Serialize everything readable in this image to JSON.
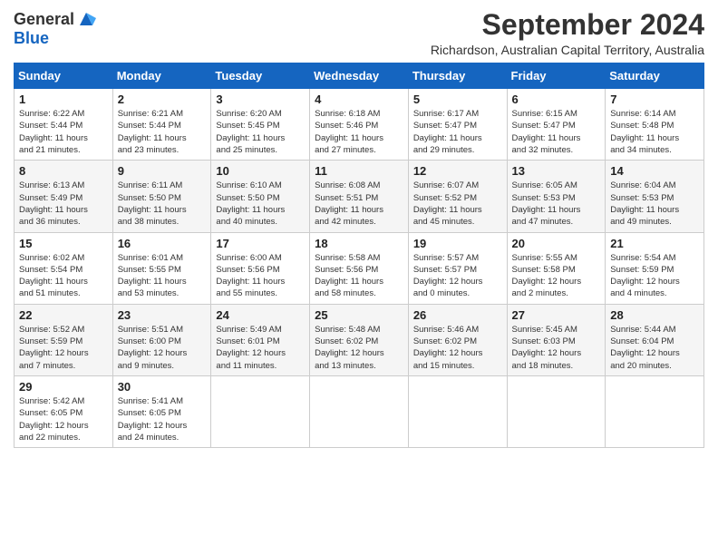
{
  "logo": {
    "general": "General",
    "blue": "Blue"
  },
  "title": "September 2024",
  "location": "Richardson, Australian Capital Territory, Australia",
  "weekdays": [
    "Sunday",
    "Monday",
    "Tuesday",
    "Wednesday",
    "Thursday",
    "Friday",
    "Saturday"
  ],
  "weeks": [
    [
      {
        "day": "1",
        "info": "Sunrise: 6:22 AM\nSunset: 5:44 PM\nDaylight: 11 hours\nand 21 minutes."
      },
      {
        "day": "2",
        "info": "Sunrise: 6:21 AM\nSunset: 5:44 PM\nDaylight: 11 hours\nand 23 minutes."
      },
      {
        "day": "3",
        "info": "Sunrise: 6:20 AM\nSunset: 5:45 PM\nDaylight: 11 hours\nand 25 minutes."
      },
      {
        "day": "4",
        "info": "Sunrise: 6:18 AM\nSunset: 5:46 PM\nDaylight: 11 hours\nand 27 minutes."
      },
      {
        "day": "5",
        "info": "Sunrise: 6:17 AM\nSunset: 5:47 PM\nDaylight: 11 hours\nand 29 minutes."
      },
      {
        "day": "6",
        "info": "Sunrise: 6:15 AM\nSunset: 5:47 PM\nDaylight: 11 hours\nand 32 minutes."
      },
      {
        "day": "7",
        "info": "Sunrise: 6:14 AM\nSunset: 5:48 PM\nDaylight: 11 hours\nand 34 minutes."
      }
    ],
    [
      {
        "day": "8",
        "info": "Sunrise: 6:13 AM\nSunset: 5:49 PM\nDaylight: 11 hours\nand 36 minutes."
      },
      {
        "day": "9",
        "info": "Sunrise: 6:11 AM\nSunset: 5:50 PM\nDaylight: 11 hours\nand 38 minutes."
      },
      {
        "day": "10",
        "info": "Sunrise: 6:10 AM\nSunset: 5:50 PM\nDaylight: 11 hours\nand 40 minutes."
      },
      {
        "day": "11",
        "info": "Sunrise: 6:08 AM\nSunset: 5:51 PM\nDaylight: 11 hours\nand 42 minutes."
      },
      {
        "day": "12",
        "info": "Sunrise: 6:07 AM\nSunset: 5:52 PM\nDaylight: 11 hours\nand 45 minutes."
      },
      {
        "day": "13",
        "info": "Sunrise: 6:05 AM\nSunset: 5:53 PM\nDaylight: 11 hours\nand 47 minutes."
      },
      {
        "day": "14",
        "info": "Sunrise: 6:04 AM\nSunset: 5:53 PM\nDaylight: 11 hours\nand 49 minutes."
      }
    ],
    [
      {
        "day": "15",
        "info": "Sunrise: 6:02 AM\nSunset: 5:54 PM\nDaylight: 11 hours\nand 51 minutes."
      },
      {
        "day": "16",
        "info": "Sunrise: 6:01 AM\nSunset: 5:55 PM\nDaylight: 11 hours\nand 53 minutes."
      },
      {
        "day": "17",
        "info": "Sunrise: 6:00 AM\nSunset: 5:56 PM\nDaylight: 11 hours\nand 55 minutes."
      },
      {
        "day": "18",
        "info": "Sunrise: 5:58 AM\nSunset: 5:56 PM\nDaylight: 11 hours\nand 58 minutes."
      },
      {
        "day": "19",
        "info": "Sunrise: 5:57 AM\nSunset: 5:57 PM\nDaylight: 12 hours\nand 0 minutes."
      },
      {
        "day": "20",
        "info": "Sunrise: 5:55 AM\nSunset: 5:58 PM\nDaylight: 12 hours\nand 2 minutes."
      },
      {
        "day": "21",
        "info": "Sunrise: 5:54 AM\nSunset: 5:59 PM\nDaylight: 12 hours\nand 4 minutes."
      }
    ],
    [
      {
        "day": "22",
        "info": "Sunrise: 5:52 AM\nSunset: 5:59 PM\nDaylight: 12 hours\nand 7 minutes."
      },
      {
        "day": "23",
        "info": "Sunrise: 5:51 AM\nSunset: 6:00 PM\nDaylight: 12 hours\nand 9 minutes."
      },
      {
        "day": "24",
        "info": "Sunrise: 5:49 AM\nSunset: 6:01 PM\nDaylight: 12 hours\nand 11 minutes."
      },
      {
        "day": "25",
        "info": "Sunrise: 5:48 AM\nSunset: 6:02 PM\nDaylight: 12 hours\nand 13 minutes."
      },
      {
        "day": "26",
        "info": "Sunrise: 5:46 AM\nSunset: 6:02 PM\nDaylight: 12 hours\nand 15 minutes."
      },
      {
        "day": "27",
        "info": "Sunrise: 5:45 AM\nSunset: 6:03 PM\nDaylight: 12 hours\nand 18 minutes."
      },
      {
        "day": "28",
        "info": "Sunrise: 5:44 AM\nSunset: 6:04 PM\nDaylight: 12 hours\nand 20 minutes."
      }
    ],
    [
      {
        "day": "29",
        "info": "Sunrise: 5:42 AM\nSunset: 6:05 PM\nDaylight: 12 hours\nand 22 minutes."
      },
      {
        "day": "30",
        "info": "Sunrise: 5:41 AM\nSunset: 6:05 PM\nDaylight: 12 hours\nand 24 minutes."
      },
      null,
      null,
      null,
      null,
      null
    ]
  ]
}
